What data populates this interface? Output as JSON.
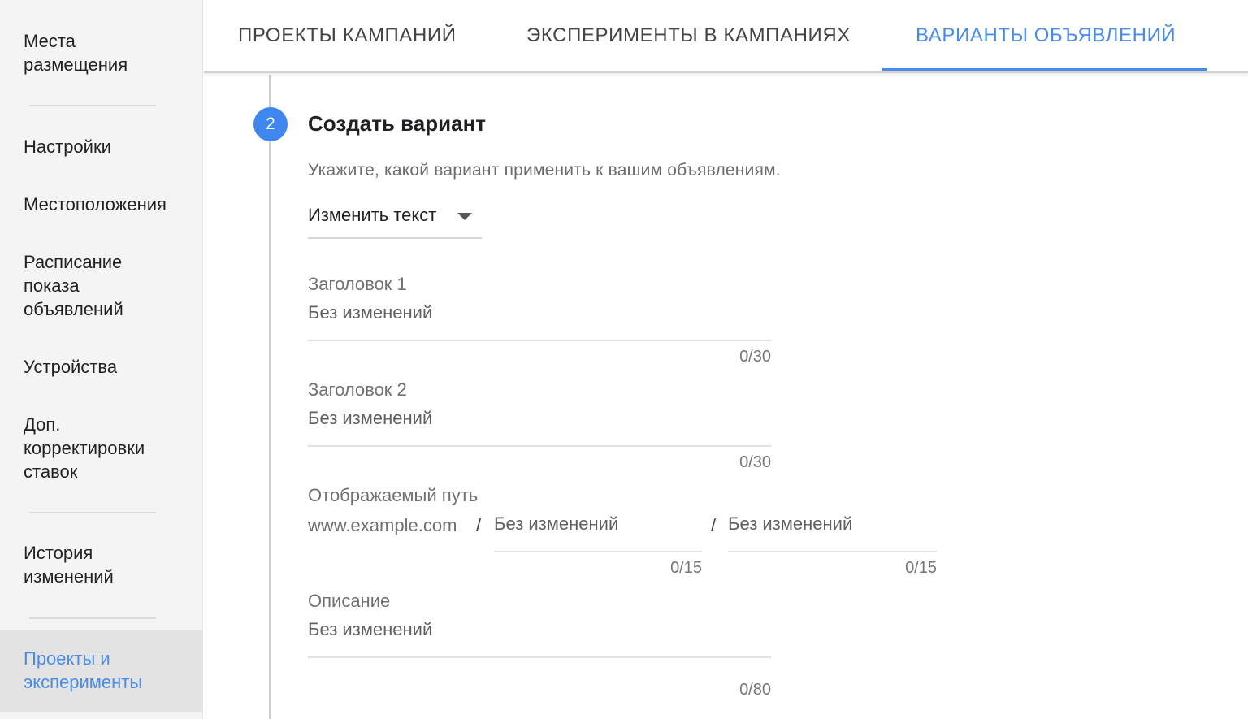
{
  "sidebar": {
    "items": [
      {
        "label": "Места\nразмещения"
      },
      {
        "label": "Настройки"
      },
      {
        "label": "Местоположения"
      },
      {
        "label": "Расписание\nпоказа\nобъявлений"
      },
      {
        "label": "Устройства"
      },
      {
        "label": "Доп.\nкорректировки\nставок"
      },
      {
        "label": "История\nизменений"
      },
      {
        "label": "Проекты и\nэксперименты"
      }
    ]
  },
  "tabs": [
    {
      "label": "ПРОЕКТЫ КАМПАНИЙ"
    },
    {
      "label": "ЭКСПЕРИМЕНТЫ В КАМПАНИЯХ"
    },
    {
      "label": "ВАРИАНТЫ ОБЪЯВЛЕНИЙ"
    }
  ],
  "colors": {
    "accent": "#4a8be8",
    "step_circle": "#3f86ef",
    "sidebar_bg": "#f4f4f4",
    "active_item_bg": "#e3e3e3"
  },
  "step": {
    "number": "2",
    "title": "Создать вариант",
    "description": "Укажите, какой вариант применить к вашим объявлениям.",
    "variant_select": {
      "value": "Изменить текст",
      "icon": "caret-down-icon"
    },
    "headline1": {
      "label": "Заголовок 1",
      "placeholder": "Без изменений",
      "counter": "0/30"
    },
    "headline2": {
      "label": "Заголовок 2",
      "placeholder": "Без изменений",
      "counter": "0/30"
    },
    "display_path": {
      "label": "Отображаемый путь",
      "domain": "www.example.com",
      "separator": "/",
      "path1": {
        "placeholder": "Без изменений",
        "counter": "0/15"
      },
      "path2": {
        "placeholder": "Без изменений",
        "counter": "0/15"
      }
    },
    "description_field": {
      "label": "Описание",
      "placeholder": "Без изменений",
      "counter": "0/80"
    }
  }
}
